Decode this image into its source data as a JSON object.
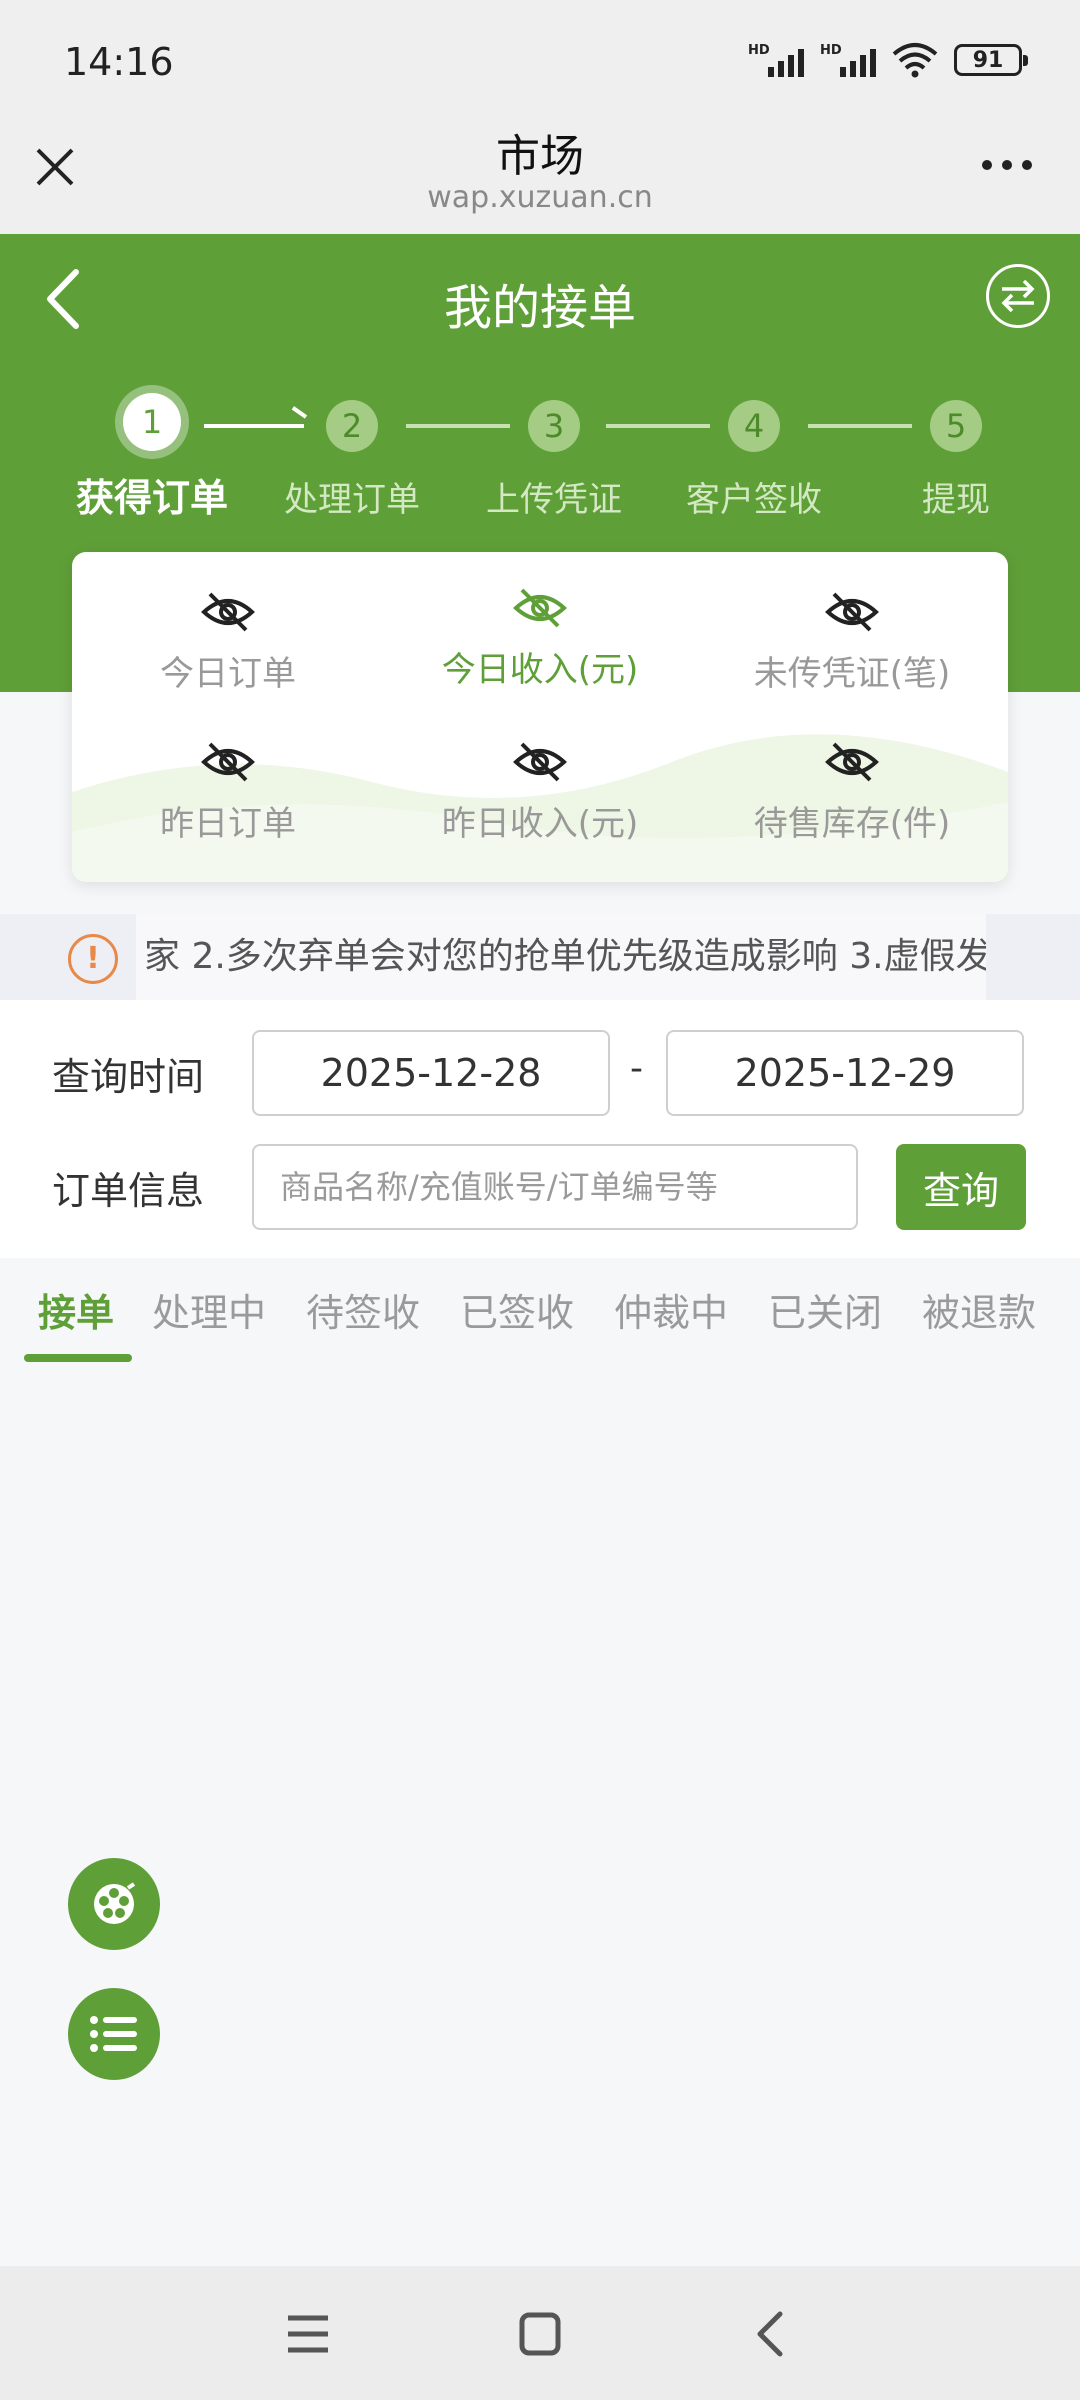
{
  "status_bar": {
    "time": "14:16",
    "battery": "91",
    "signal_label": "HD"
  },
  "browser": {
    "title": "市场",
    "url": "wap.xuzuan.cn"
  },
  "header": {
    "title": "我的接单"
  },
  "steps": [
    {
      "number": "1",
      "label": "获得订单",
      "active": true
    },
    {
      "number": "2",
      "label": "处理订单"
    },
    {
      "number": "3",
      "label": "上传凭证"
    },
    {
      "number": "4",
      "label": "客户签收"
    },
    {
      "number": "5",
      "label": "提现"
    }
  ],
  "stats": [
    {
      "label": "今日订单"
    },
    {
      "label": "今日收入(元)",
      "highlight": true
    },
    {
      "label": "未传凭证(笔)"
    },
    {
      "label": "昨日订单"
    },
    {
      "label": "昨日收入(元)"
    },
    {
      "label": "待售库存(件)"
    }
  ],
  "notice": {
    "text": "家 2.多次弃单会对您的抢单优先级造成影响 3.虚假发"
  },
  "filter": {
    "time_label": "查询时间",
    "start_date": "2025-12-28",
    "separator": "-",
    "end_date": "2025-12-29",
    "order_label": "订单信息",
    "search_placeholder": "商品名称/充值账号/订单编号等",
    "query_button": "查询"
  },
  "tabs": [
    {
      "label": "接单",
      "active": true
    },
    {
      "label": "处理中"
    },
    {
      "label": "待签收"
    },
    {
      "label": "已签收"
    },
    {
      "label": "仲裁中"
    },
    {
      "label": "已关闭"
    },
    {
      "label": "被退款"
    }
  ],
  "colors": {
    "brand_green": "#5f9f38",
    "notice_orange": "#e8894a"
  },
  "icons": {
    "fab_top": "film-reel-icon",
    "fab_bottom": "list-icon",
    "nav": [
      "menu-icon",
      "home-icon",
      "back-icon"
    ]
  }
}
